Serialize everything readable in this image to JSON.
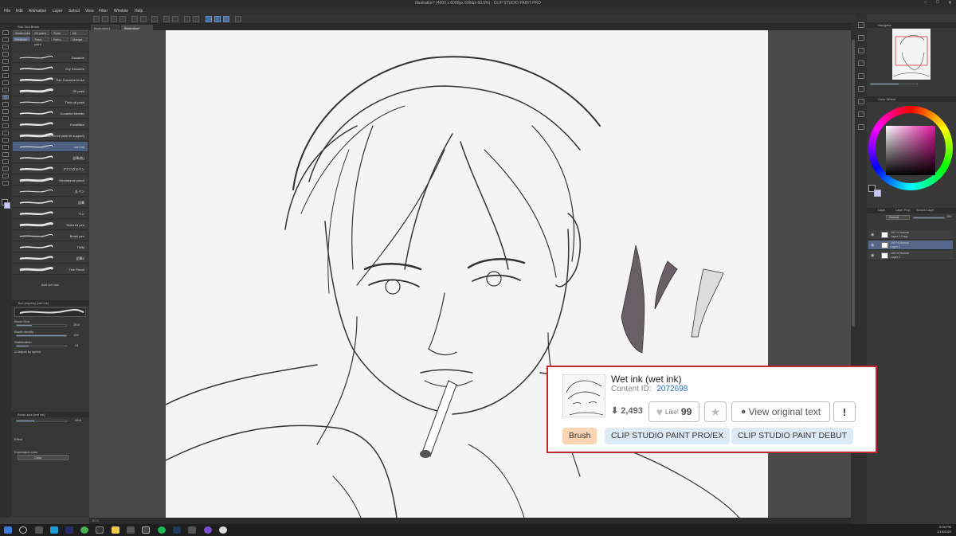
{
  "window": {
    "title": "Illustration* (4000 x 6000px 600dpi 60.5%) - CLIP STUDIO PAINT PRO"
  },
  "menu": [
    "File",
    "Edit",
    "Animation",
    "Layer",
    "Select",
    "View",
    "Filter",
    "Window",
    "Help"
  ],
  "sub_tool": {
    "header": "Sub Tool Brush",
    "tabs": [
      "Watercolor",
      "Oil paint",
      "Sumi",
      "Ink",
      "Realistic",
      "Thick paint",
      "Retro",
      "Manga"
    ],
    "brushes": [
      {
        "name": "Gouache"
      },
      {
        "name": "Dry Gouache"
      },
      {
        "name": "Thin Gouache brush"
      },
      {
        "name": "Oil paint"
      },
      {
        "name": "Thick oil paint"
      },
      {
        "name": "Gouache blender"
      },
      {
        "name": "Pointillism"
      },
      {
        "name": "Perfect Pencil (with tilt support)"
      },
      {
        "name": "wet ink",
        "selected": true
      },
      {
        "name": "鉛筆(乾)"
      },
      {
        "name": "アナログGペン"
      },
      {
        "name": "Mechanical pencil"
      },
      {
        "name": "丸ペン"
      },
      {
        "name": "鉛筆"
      },
      {
        "name": "ペン"
      },
      {
        "name": "Textured pen"
      },
      {
        "name": "Brush pen"
      },
      {
        "name": "TWM"
      },
      {
        "name": "鉛筆2"
      },
      {
        "name": "Thin Pencil"
      }
    ],
    "add_sub_tool": "Add sub tool"
  },
  "tool_property": {
    "header": "Tool property [wet ink]",
    "brush_label": "wet ink",
    "brush_size_label": "Brush Size",
    "brush_size": "28.6",
    "brush_density_label": "Brush density",
    "brush_density": "100",
    "stabilization_label": "Stabilization",
    "stabilization": "24",
    "adjust_speed_label": "Adjust by speed"
  },
  "brush_size_panel": {
    "header": "Brush size [wet ink]",
    "value": "28.6"
  },
  "color_panel": {
    "effect_label": "Effect",
    "expression_label": "Expression color",
    "expression_value": "Color"
  },
  "doc_tabs": [
    "Illustration1",
    "Illustration*"
  ],
  "status": {
    "zoom": "60.5"
  },
  "navigator": {
    "header": "Navigator"
  },
  "color_wheel": {
    "header": "Color Wheel"
  },
  "layer_panel": {
    "tabs": [
      "Layer",
      "Layer Prop",
      "Search Layer"
    ],
    "blend_mode": "Normal",
    "opacity": "100",
    "layers": [
      {
        "opacity": "100 % Normal",
        "name": "Layer 2 Copy",
        "selected": false
      },
      {
        "opacity": "100 % Normal",
        "name": "Layer 1",
        "selected": true
      },
      {
        "opacity": "100 % Normal",
        "name": "Layer 2",
        "selected": false
      }
    ]
  },
  "popup": {
    "title": "Wet ink (wet ink)",
    "content_id_label": "Content ID:",
    "content_id": "2072698",
    "downloads": "2,493",
    "like_label": "Like!",
    "like_count": "99",
    "view_original": "View original text",
    "report": "!",
    "tags": [
      "Brush",
      "CLIP STUDIO PAINT PRO/EX",
      "CLIP STUDIO PAINT DEBUT"
    ]
  },
  "taskbar": {
    "time": "5:06 PM",
    "date": "2/19/2025"
  },
  "colors": {
    "popup_border": "#c0282f",
    "brush_tag": "#f9d5b4",
    "product_tag": "#dceaf6",
    "content_id_link": "#2f6fc2"
  }
}
